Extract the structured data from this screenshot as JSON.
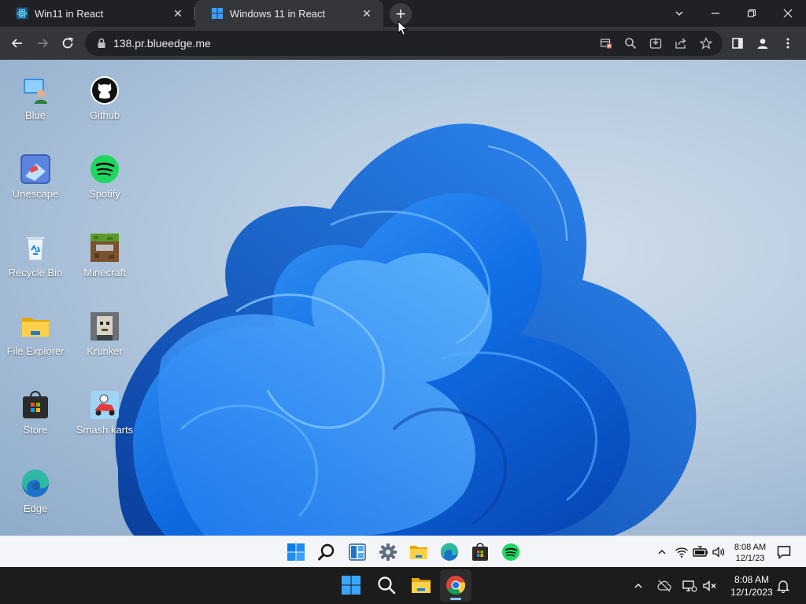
{
  "browser": {
    "tabs": [
      {
        "title": "Win11 in React",
        "active": false
      },
      {
        "title": "Windows 11 in React",
        "active": true
      }
    ],
    "new_tab_label": "+",
    "url": "138.pr.blueedge.me"
  },
  "desktop": {
    "icons": [
      {
        "label": "Blue",
        "icon": "blue-user-icon"
      },
      {
        "label": "Github",
        "icon": "github-icon"
      },
      {
        "label": "Unescape",
        "icon": "unescape-icon"
      },
      {
        "label": "Spotify",
        "icon": "spotify-icon"
      },
      {
        "label": "Recycle Bin",
        "icon": "recycle-bin-icon"
      },
      {
        "label": "Minecraft",
        "icon": "minecraft-icon"
      },
      {
        "label": "File Explorer",
        "icon": "folder-icon"
      },
      {
        "label": "Krunker",
        "icon": "krunker-icon"
      },
      {
        "label": "Store",
        "icon": "store-icon"
      },
      {
        "label": "Smash karts",
        "icon": "smash-karts-icon"
      },
      {
        "label": "Edge",
        "icon": "edge-icon"
      }
    ]
  },
  "inner_taskbar": {
    "time": "8:08 AM",
    "date": "12/1/23"
  },
  "host_taskbar": {
    "time": "8:08 AM",
    "date": "12/1/2023"
  },
  "colors": {
    "chrome_dark": "#202124",
    "chrome_toolbar": "#35363a",
    "win_blue": "#0a63e0",
    "spotify_green": "#1ed760",
    "edge_teal": "#2fb8a1"
  }
}
